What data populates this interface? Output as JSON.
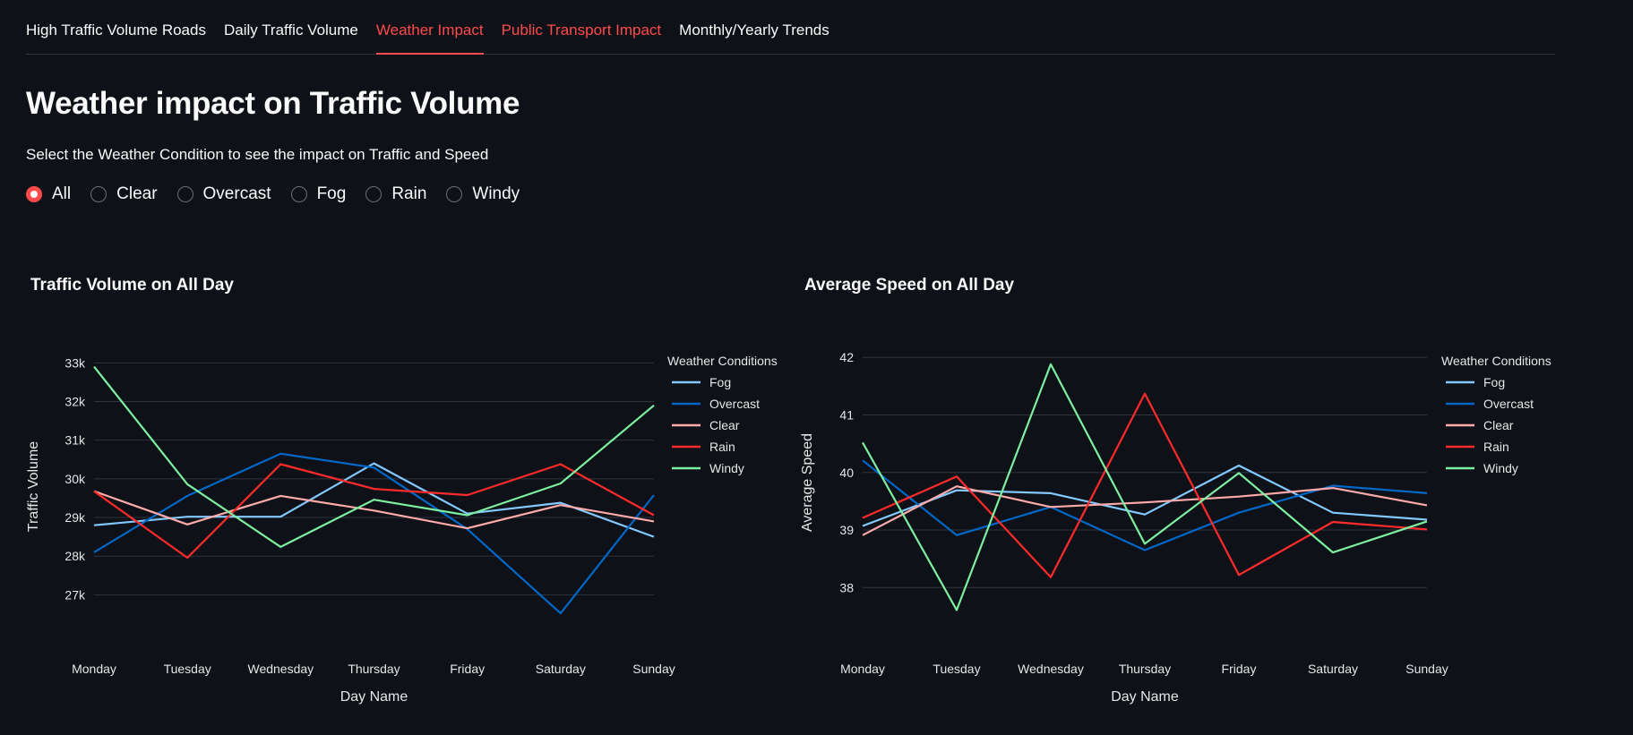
{
  "tabs": [
    {
      "label": "High Traffic Volume Roads"
    },
    {
      "label": "Daily Traffic Volume"
    },
    {
      "label": "Weather Impact"
    },
    {
      "label": "Public Transport Impact"
    },
    {
      "label": "Monthly/Yearly Trends"
    }
  ],
  "page": {
    "title": "Weather impact on Traffic Volume",
    "instruction": "Select the Weather Condition to see the impact on Traffic and Speed",
    "selected_option": "All",
    "options": [
      "All",
      "Clear",
      "Overcast",
      "Fog",
      "Rain",
      "Windy"
    ]
  },
  "colors": {
    "accent": "#ff4b4b",
    "background": "#0e1117",
    "Fog": "#83c9ff",
    "Overcast": "#0068c9",
    "Clear": "#ffabab",
    "Rain": "#ff2b2b",
    "Windy": "#7defa1"
  },
  "chart_data": [
    {
      "type": "line",
      "title": "Traffic Volume on All Day",
      "xlabel": "Day Name",
      "ylabel": "Traffic Volume",
      "categories": [
        "Monday",
        "Tuesday",
        "Wednesday",
        "Thursday",
        "Friday",
        "Saturday",
        "Sunday"
      ],
      "ylim": [
        26500,
        33100
      ],
      "yticks": [
        27000,
        28000,
        29000,
        30000,
        31000,
        32000,
        33000
      ],
      "ytick_labels": [
        "27k",
        "28k",
        "29k",
        "30k",
        "31k",
        "32k",
        "33k"
      ],
      "grid": true,
      "legend": {
        "title": "Weather Conditions",
        "position": "top-right"
      },
      "series": [
        {
          "name": "Fog",
          "values": [
            28800,
            29020,
            29020,
            30400,
            29100,
            29380,
            28500
          ]
        },
        {
          "name": "Overcast",
          "values": [
            28100,
            29560,
            30650,
            30290,
            28700,
            26520,
            29580
          ]
        },
        {
          "name": "Clear",
          "values": [
            29680,
            28820,
            29560,
            29180,
            28720,
            29320,
            28900
          ]
        },
        {
          "name": "Rain",
          "values": [
            29680,
            27960,
            30380,
            29740,
            29580,
            30380,
            29060
          ]
        },
        {
          "name": "Windy",
          "values": [
            32900,
            29860,
            28240,
            29460,
            29060,
            29880,
            31900
          ]
        }
      ]
    },
    {
      "type": "line",
      "title": "Average Speed on All Day",
      "xlabel": "Day Name",
      "ylabel": "Average Speed",
      "categories": [
        "Monday",
        "Tuesday",
        "Wednesday",
        "Thursday",
        "Friday",
        "Saturday",
        "Sunday"
      ],
      "ylim": [
        37.6,
        42.05
      ],
      "yticks": [
        38,
        39,
        40,
        41,
        42
      ],
      "ytick_labels": [
        "38",
        "39",
        "40",
        "41",
        "42"
      ],
      "grid": true,
      "legend": {
        "title": "Weather Conditions",
        "position": "top-right"
      },
      "series": [
        {
          "name": "Fog",
          "values": [
            39.07,
            39.69,
            39.64,
            39.27,
            40.12,
            39.3,
            39.18
          ]
        },
        {
          "name": "Overcast",
          "values": [
            40.21,
            38.91,
            39.4,
            38.65,
            39.3,
            39.77,
            39.64
          ]
        },
        {
          "name": "Clear",
          "values": [
            38.91,
            39.76,
            39.4,
            39.48,
            39.58,
            39.73,
            39.43
          ]
        },
        {
          "name": "Rain",
          "values": [
            39.21,
            39.93,
            38.18,
            41.37,
            38.22,
            39.14,
            39.01
          ]
        },
        {
          "name": "Windy",
          "values": [
            40.52,
            37.61,
            41.88,
            38.76,
            39.99,
            38.61,
            39.15
          ]
        }
      ]
    }
  ]
}
